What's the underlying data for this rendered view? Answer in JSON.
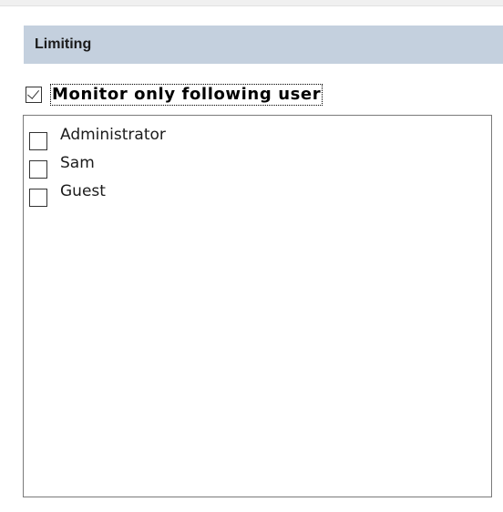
{
  "section": {
    "title": "Limiting"
  },
  "monitor_option": {
    "label": "Monitor only following user",
    "checked": true
  },
  "users": [
    {
      "label": "Administrator",
      "checked": false
    },
    {
      "label": "Sam",
      "checked": false
    },
    {
      "label": "Guest",
      "checked": false
    }
  ],
  "colors": {
    "header_bg": "#c4d0de",
    "list_border": "#7a7a7a"
  }
}
